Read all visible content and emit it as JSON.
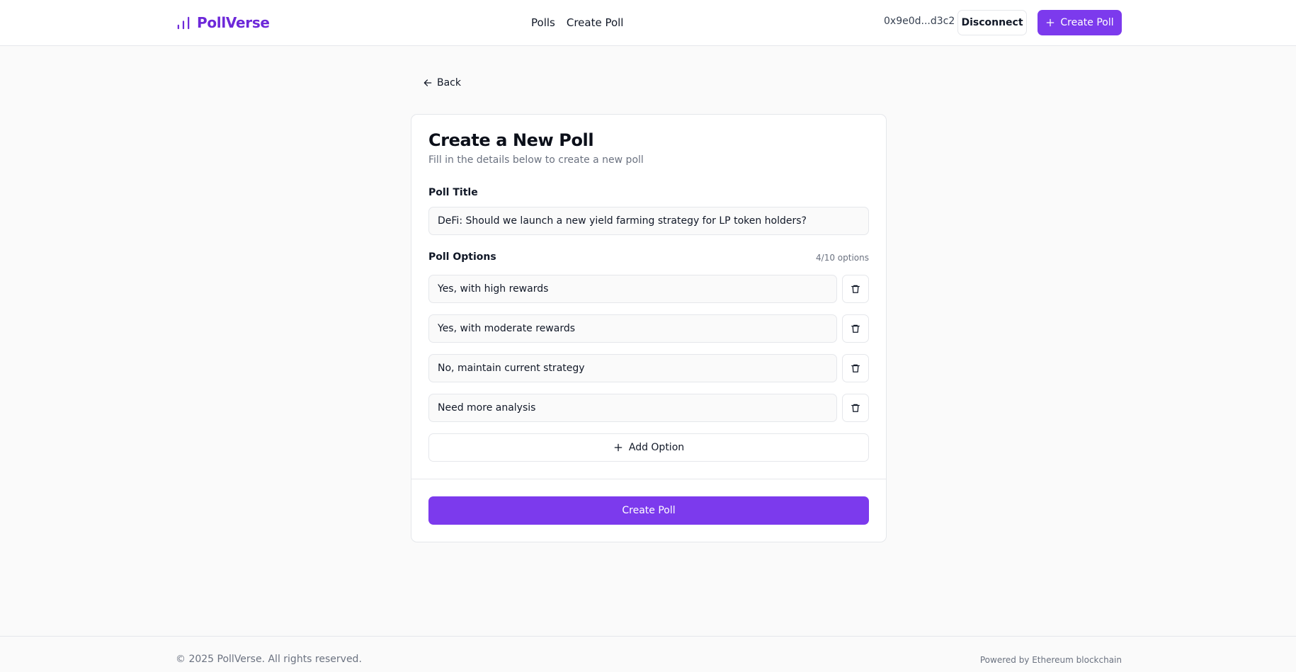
{
  "header": {
    "brand": "PollVerse",
    "nav": [
      "Polls",
      "Create Poll"
    ],
    "wallet_address": "0x9e0d...d3c2",
    "disconnect_label": "Disconnect",
    "create_poll_label": "Create Poll",
    "accent_color": "#7c3aed",
    "brand_color": "#6d28d9"
  },
  "back_label": "Back",
  "form": {
    "title": "Create a New Poll",
    "subtitle": "Fill in the details below to create a new poll",
    "poll_title_label": "Poll Title",
    "poll_title_value": "DeFi: Should we launch a new yield farming strategy for LP token holders?",
    "options_label": "Poll Options",
    "options_count": "4/10 options",
    "options": [
      "Yes, with high rewards",
      "Yes, with moderate rewards",
      "No, maintain current strategy",
      "Need more analysis"
    ],
    "add_option_label": "Add Option",
    "submit_label": "Create Poll"
  },
  "footer": {
    "copyright": "© 2025 PollVerse. All rights reserved.",
    "powered_by": "Powered by Ethereum blockchain"
  },
  "icons": {
    "brand": "bar-chart-icon",
    "back": "arrow-left-icon",
    "plus": "plus-icon",
    "delete": "trash-icon"
  }
}
